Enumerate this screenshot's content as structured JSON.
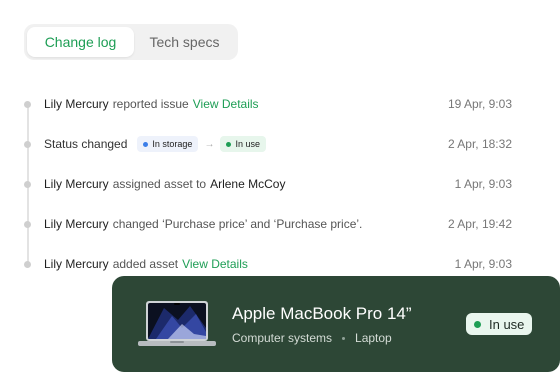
{
  "tabs": {
    "change_log": "Change log",
    "tech_specs": "Tech specs"
  },
  "log": [
    {
      "actor": "Lily Mercury",
      "action": "reported issue",
      "link": "View Details",
      "time": "19 Apr, 9:03"
    },
    {
      "action": "Status changed",
      "from_status": "In storage",
      "to_status": "In use",
      "time": "2 Apr, 18:32"
    },
    {
      "actor": "Lily Mercury",
      "action": "assigned asset to",
      "target": "Arlene McCoy",
      "time": "1 Apr, 9:03"
    },
    {
      "actor": "Lily Mercury",
      "action": "changed ‘Purchase price’ and ‘Purchase price’.",
      "time": "2 Apr, 19:42"
    },
    {
      "actor": "Lily Mercury",
      "action": "added asset",
      "link": "View Details",
      "time": "1 Apr, 9:03"
    }
  ],
  "asset_card": {
    "name": "Apple MacBook Pro 14”",
    "category": "Computer systems",
    "type": "Laptop",
    "status": "In use",
    "image_icon": "laptop-icon"
  },
  "colors": {
    "accent_green": "#1e9e55",
    "card_bg": "#2d4736",
    "storage_blue": "#3c7ee8"
  }
}
